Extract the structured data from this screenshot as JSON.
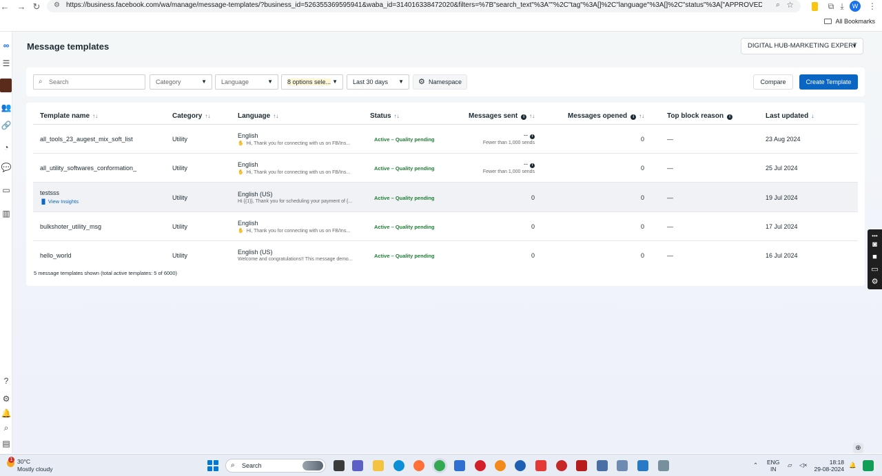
{
  "browser": {
    "url": "https://business.facebook.com/wa/manage/message-templates/?business_id=526355369595941&waba_id=314016338472020&filters=%7B\"search_text\"%3A\"\"%2C\"tag\"%3A[]%2C\"language\"%3A[]%2C\"status\"%3A[\"APPROVED\"%2C\"IN_APPEAL\"...",
    "profile_initial": "W",
    "bookmarks_label": "All Bookmarks"
  },
  "header": {
    "title": "Message templates",
    "business_name": "DIGITAL HUB-MARKETING EXPERT"
  },
  "filters": {
    "search_placeholder": "Search",
    "category": "Category",
    "language": "Language",
    "status": "8 options sele...",
    "date_range": "Last 30 days",
    "namespace": "Namespace",
    "compare": "Compare",
    "create": "Create Template"
  },
  "table": {
    "columns": [
      "Template name",
      "Category",
      "Language",
      "Status",
      "Messages sent",
      "Messages opened",
      "Top block reason",
      "Last updated"
    ],
    "rows": [
      {
        "name": "all_tools_23_augest_mix_soft_list",
        "insights": "",
        "category": "Utility",
        "language": "English",
        "preview": "Hi, Thank you for connecting with us on FB/Ins...",
        "status": "Active – Quality pending",
        "sent": "--",
        "sent_note": "Fewer than 1,000 sends",
        "opened": "0",
        "block": "—",
        "updated": "23 Aug 2024"
      },
      {
        "name": "all_utility_softwares_conformation_",
        "insights": "",
        "category": "Utility",
        "language": "English",
        "preview": "Hi, Thank you for connecting with us on FB/Ins...",
        "status": "Active – Quality pending",
        "sent": "--",
        "sent_note": "Fewer than 1,000 sends",
        "opened": "0",
        "block": "—",
        "updated": "25 Jul 2024"
      },
      {
        "name": "testsss",
        "insights": "View Insights",
        "category": "Utility",
        "language": "English (US)",
        "preview": "Hi {{1}}, Thank you for scheduling your payment of {...",
        "status": "Active – Quality pending",
        "sent": "0",
        "sent_note": "",
        "opened": "0",
        "block": "—",
        "updated": "19 Jul 2024"
      },
      {
        "name": "bulkshoter_utility_msg",
        "insights": "",
        "category": "Utility",
        "language": "English",
        "preview": "Hi, Thank you for connecting with us on FB/Ins...",
        "status": "Active – Quality pending",
        "sent": "0",
        "sent_note": "",
        "opened": "0",
        "block": "—",
        "updated": "17 Jul 2024"
      },
      {
        "name": "hello_world",
        "insights": "",
        "category": "Utility",
        "language": "English (US)",
        "preview": "Welcome and congratulations!! This message demo...",
        "status": "Active – Quality pending",
        "sent": "0",
        "sent_note": "",
        "opened": "0",
        "block": "—",
        "updated": "16 Jul 2024"
      }
    ],
    "footer": "5 message templates shown (total active templates: 5 of 6000)"
  },
  "taskbar": {
    "weather_badge": "1",
    "temperature": "30°C",
    "condition": "Mostly cloudy",
    "search": "Search",
    "lang_top": "ENG",
    "lang_bottom": "IN",
    "time": "18:18",
    "date": "29-08-2024"
  },
  "colors": {
    "primary": "#0a66c2",
    "status_green": "#1e7e34",
    "meta_blue": "#0866ff"
  }
}
